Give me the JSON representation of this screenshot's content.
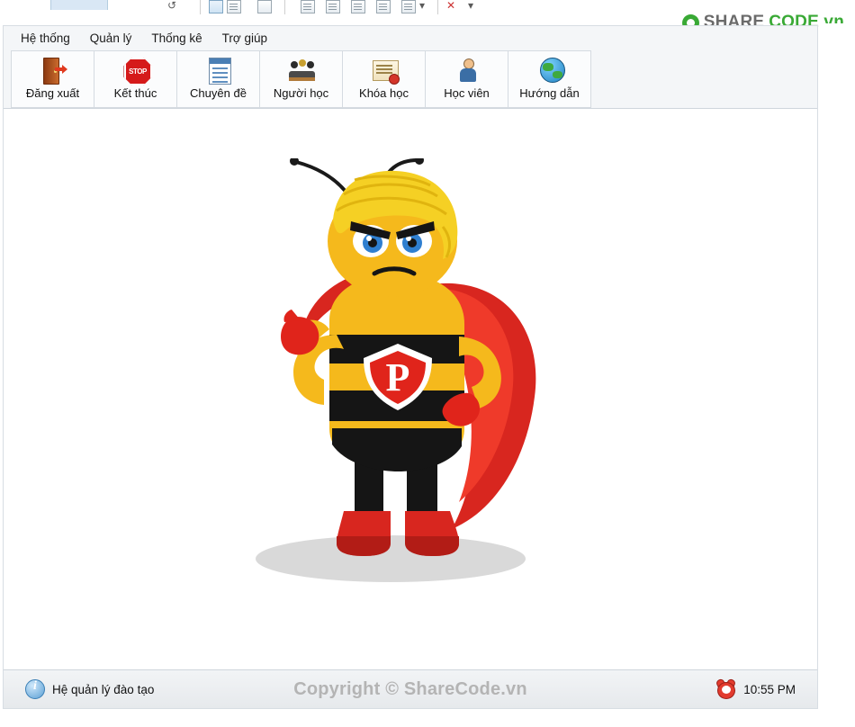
{
  "branding": {
    "logo_share": "SHARE",
    "logo_code": "CODE.vn",
    "watermark": "ShareCode.vn"
  },
  "menubar": {
    "items": [
      {
        "label": "Hệ thống",
        "name": "menu-he-thong"
      },
      {
        "label": "Quản lý",
        "name": "menu-quan-ly"
      },
      {
        "label": "Thống kê",
        "name": "menu-thong-ke"
      },
      {
        "label": "Trợ giúp",
        "name": "menu-tro-giup"
      }
    ]
  },
  "toolbar": {
    "buttons": [
      {
        "label": "Đăng xuất",
        "icon": "exit-door-icon"
      },
      {
        "label": "Kết thúc",
        "icon": "stop-sign-icon"
      },
      {
        "label": "Chuyên đề",
        "icon": "document-icon"
      },
      {
        "label": "Người học",
        "icon": "people-meeting-icon"
      },
      {
        "label": "Khóa học",
        "icon": "certificate-icon"
      },
      {
        "label": "Học viên",
        "icon": "user-icon"
      },
      {
        "label": "Hướng dẫn",
        "icon": "globe-icon"
      }
    ]
  },
  "statusbar": {
    "status_text": "Hệ quản lý đào tạo",
    "copyright": "Copyright © ShareCode.vn",
    "time": "10:55 PM",
    "info_icon": "info-icon",
    "clock_icon": "alarm-clock-icon"
  }
}
